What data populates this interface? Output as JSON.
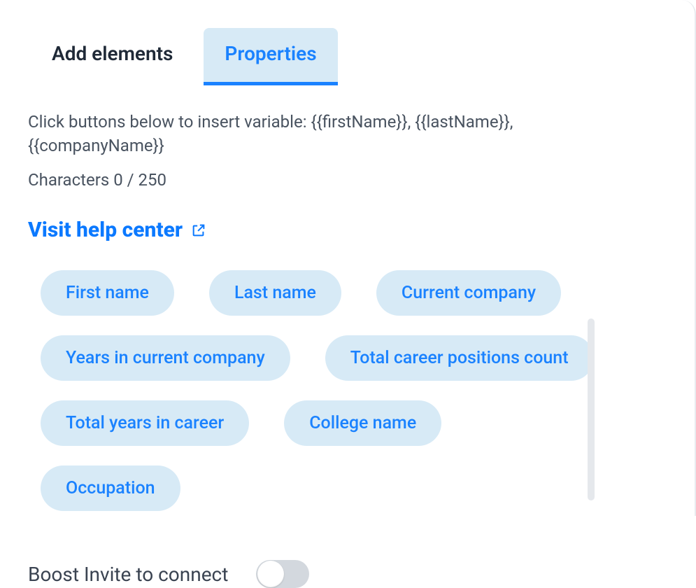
{
  "tabs": {
    "add_elements": "Add elements",
    "properties": "Properties"
  },
  "hint": "Click buttons below to insert variable: {{firstName}}, {{lastName}}, {{companyName}}",
  "char_counter": "Characters 0 / 250",
  "help_link": "Visit help center",
  "pills": [
    "First name",
    "Last name",
    "Current company",
    "Years in current company",
    "Total career positions count",
    "Total years in career",
    "College name",
    "Occupation"
  ],
  "boost_label": "Boost Invite to connect"
}
